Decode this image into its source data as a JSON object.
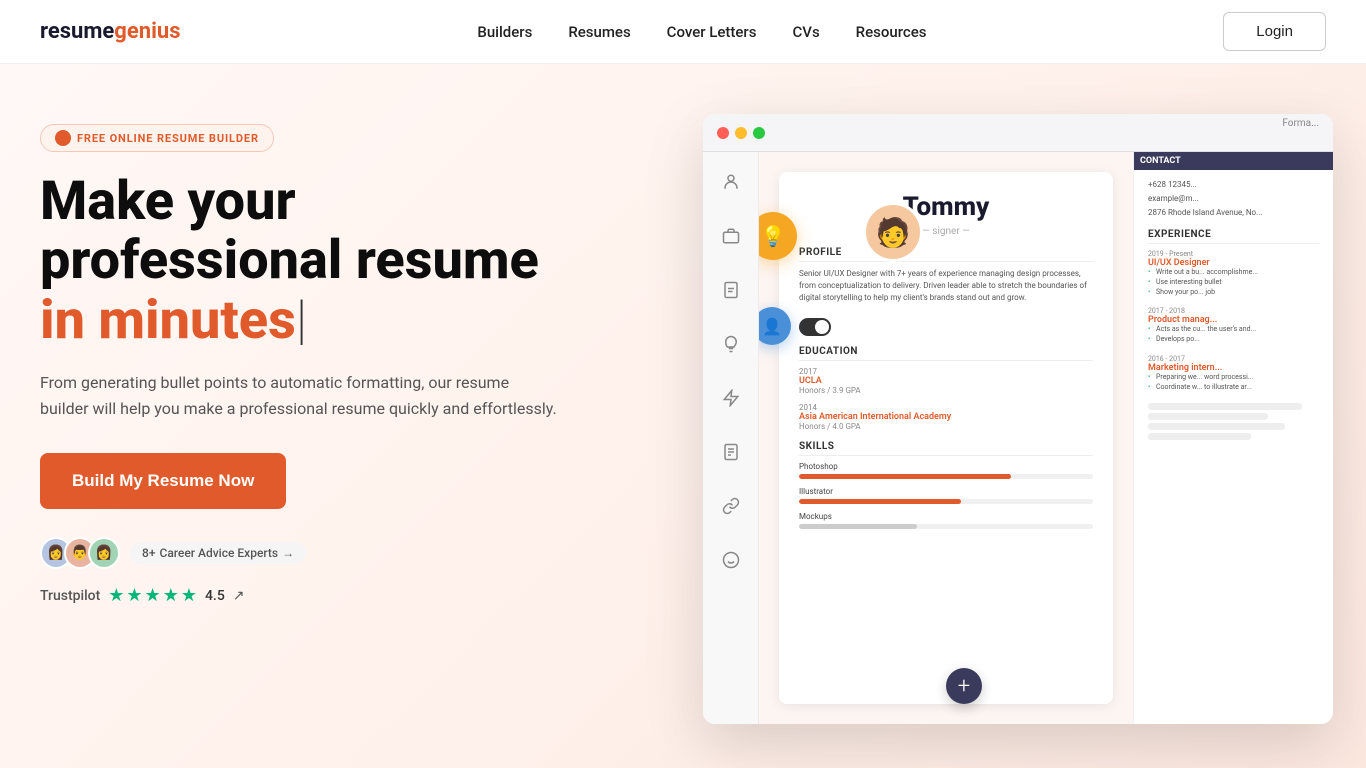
{
  "nav": {
    "logo_resume": "resume",
    "logo_genius": "genius",
    "links": [
      {
        "label": "Builders",
        "id": "builders"
      },
      {
        "label": "Resumes",
        "id": "resumes"
      },
      {
        "label": "Cover Letters",
        "id": "cover-letters"
      },
      {
        "label": "CVs",
        "id": "cvs"
      },
      {
        "label": "Resources",
        "id": "resources"
      }
    ],
    "login_label": "Login"
  },
  "hero": {
    "badge_text": "FREE ONLINE RESUME BUILDER",
    "title_line1": "Make your",
    "title_line2": "professional resume",
    "title_accent": "in minutes",
    "cursor": "|",
    "description": "From generating bullet points to automatic formatting, our resume builder will help you make a professional resume quickly and effortlessly.",
    "cta_label": "Build My Resume Now",
    "expert_count": "8+",
    "expert_label": "Career Advice Experts",
    "expert_arrow": "→",
    "trustpilot_label": "Trustpilot",
    "rating": "4.5",
    "rating_arrow": "↗"
  },
  "mockup": {
    "format_label": "Forma...",
    "resume": {
      "name": "Tommy",
      "role": "signer",
      "profile_title": "PROFILE",
      "profile_text": "Senior UI/UX Designer with 7+ years of experience managing design processes, from conceptualization to delivery. Driven leader able to stretch the boundaries of digital storytelling to help my client's brands stand out and grow.",
      "education_title": "EDUCATION",
      "edu_items": [
        {
          "year": "2017",
          "school": "UCLA",
          "honors": "Honors / 3.9 GPA"
        },
        {
          "year": "2014",
          "school": "Asia American International Academy",
          "honors": "Honors / 4.0 GPA"
        }
      ],
      "skills_title": "SKILLS",
      "skills": [
        {
          "name": "Photoshop",
          "pct": 72
        },
        {
          "name": "Illustrator",
          "pct": 55
        },
        {
          "name": "Mockups",
          "pct": 40
        }
      ],
      "contact_title": "CONTACT",
      "contact_items": [
        "+628 12345...",
        "example@m...",
        "2876 Rhode Island Avenue, No..."
      ],
      "experience_title": "EXPERIENCE",
      "exp_items": [
        {
          "period": "2019 - Present",
          "title": "UI/UX Designer",
          "bullets": [
            "Write out a bu... accomplishme...",
            "Use interesting bullet",
            "Show your po... job"
          ]
        },
        {
          "period": "2017 - 2018",
          "title": "Product manag...",
          "bullets": [
            "Acts as the cu... the user's and...",
            "Develops po..."
          ]
        },
        {
          "period": "2016 - 2017",
          "title": "Marketing intern...",
          "bullets": [
            "Preparing we... word processi...",
            "Coordinate w... to illustrate ar..."
          ]
        }
      ]
    },
    "sidebar_icons": [
      "person",
      "briefcase",
      "document",
      "lightbulb",
      "bolt",
      "file",
      "link",
      "smiley"
    ]
  }
}
